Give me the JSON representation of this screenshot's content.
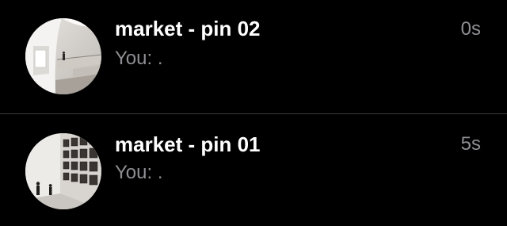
{
  "chats": [
    {
      "title": "market - pin 02",
      "preview": "You: .",
      "time": "0s",
      "avatar_icon": "museum-interior-photo"
    },
    {
      "title": "market - pin 01",
      "preview": "You: .",
      "time": "5s",
      "avatar_icon": "gallery-wall-photo"
    }
  ],
  "colors": {
    "background": "#000000",
    "title": "#ffffff",
    "secondary_text": "#8e8e93",
    "separator": "#3a3a3c"
  }
}
